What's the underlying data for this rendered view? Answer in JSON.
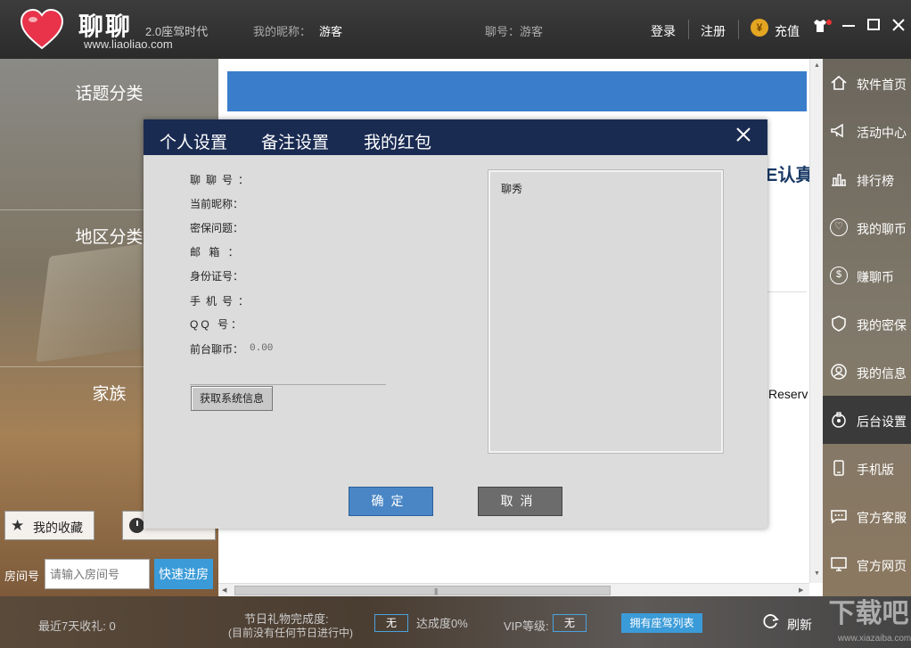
{
  "header": {
    "brand": "聊聊",
    "tagline": "2.0座驾时代",
    "url": "www.liaoliao.com",
    "nickname_label": "我的昵称：",
    "nickname_value": "游客",
    "id_label": "聊号：游客",
    "login": "登录",
    "register": "注册",
    "coin_symbol": "¥",
    "recharge": "充值"
  },
  "left": {
    "categories": [
      "话题分类",
      "地区分类",
      "家族"
    ],
    "favorites": "我的收藏",
    "room_label": "房间号",
    "room_placeholder": "请输入房间号",
    "quick_enter": "快速进房"
  },
  "main": {
    "fragment_text": "E认真",
    "reserv_text": "Reserv"
  },
  "sidebar": {
    "items": [
      {
        "label": "软件首页",
        "icon": "home-icon"
      },
      {
        "label": "活动中心",
        "icon": "megaphone-icon"
      },
      {
        "label": "排行榜",
        "icon": "bar-chart-icon"
      },
      {
        "label": "我的聊币",
        "icon": "heart-coin-icon"
      },
      {
        "label": "赚聊币",
        "icon": "dollar-icon"
      },
      {
        "label": "我的密保",
        "icon": "shield-icon"
      },
      {
        "label": "我的信息",
        "icon": "user-icon"
      },
      {
        "label": "后台设置",
        "icon": "settings-icon"
      },
      {
        "label": "手机版",
        "icon": "phone-icon"
      },
      {
        "label": "官方客服",
        "icon": "chat-icon"
      },
      {
        "label": "官方网页",
        "icon": "monitor-icon"
      }
    ],
    "active_index": 7
  },
  "bottom": {
    "gifts_7days": "最近7天收礼: 0",
    "holiday_title": "节日礼物完成度:",
    "holiday_sub": "(目前没有任何节日进行中)",
    "holiday_value": "无",
    "progress": "达成度0%",
    "vip_label": "VIP等级:",
    "vip_value": "无",
    "vip_list": "拥有座驾列表",
    "refresh": "刷新",
    "watermark": "下载吧",
    "watermark_sub": "www.xiazaiba.com"
  },
  "dialog": {
    "tabs": [
      "个人设置",
      "备注设置",
      "我的红包"
    ],
    "fields": [
      {
        "label": "聊聊号：",
        "spaced": true
      },
      {
        "label": "当前昵称："
      },
      {
        "label": "密保问题："
      },
      {
        "label": "邮  箱 ：",
        "spaced": true
      },
      {
        "label": "身份证号："
      },
      {
        "label": "手机号：",
        "spaced": true
      },
      {
        "label": "QQ  号：",
        "spaced": true
      },
      {
        "label": "前台聊币："
      }
    ],
    "coin_value": "0.00",
    "sysinfo_button": "获取系统信息",
    "show_caption": "聊秀",
    "ok": "确定",
    "cancel": "取消"
  },
  "colors": {
    "accent_blue": "#3b9bd8",
    "dialog_header": "#1a2b52",
    "banner_blue": "#3a7dcb"
  }
}
